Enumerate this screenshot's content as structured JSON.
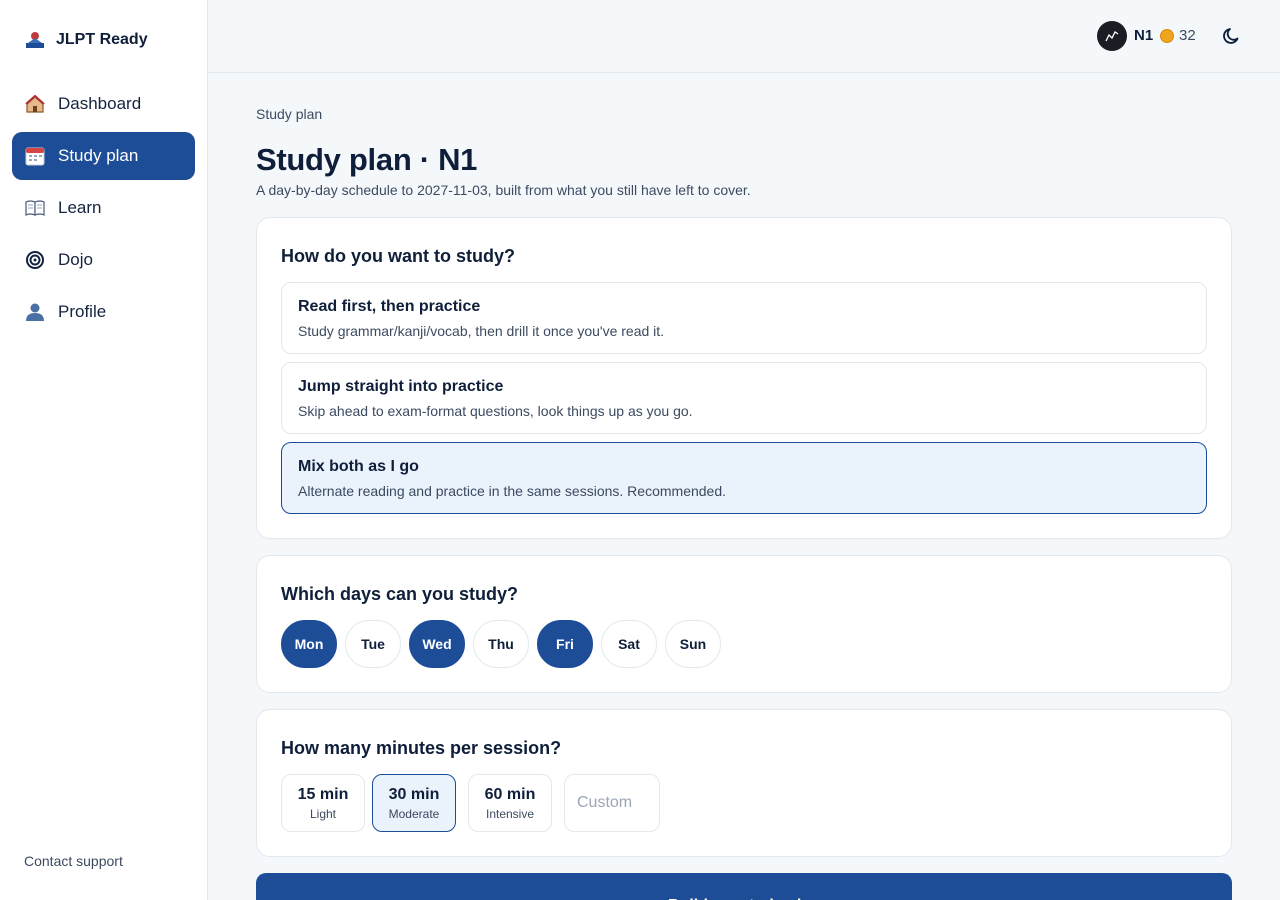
{
  "sidebar": {
    "brand": "JLPT Ready",
    "items": [
      {
        "label": "Dashboard",
        "icon": "house-icon"
      },
      {
        "label": "Study plan",
        "icon": "calendar-icon"
      },
      {
        "label": "Learn",
        "icon": "book-icon"
      },
      {
        "label": "Dojo",
        "icon": "target-icon"
      },
      {
        "label": "Profile",
        "icon": "person-icon"
      }
    ],
    "active_item": "Study plan",
    "support": "Contact support"
  },
  "topbar": {
    "level": "N1",
    "coins": "32",
    "icons": [
      "avatar",
      "coin-icon",
      "moon-icon"
    ]
  },
  "page": {
    "breadcrumb": "Study plan",
    "title": "Study plan · N1",
    "subtitle": "A day-by-day schedule to 2027-11-03, built from what you still have left to cover."
  },
  "study_mode": {
    "heading": "How do you want to study?",
    "options": [
      {
        "title": "Read first, then practice",
        "desc": "Study grammar/kanji/vocab, then drill it once you've read it."
      },
      {
        "title": "Jump straight into practice",
        "desc": "Skip ahead to exam-format questions, look things up as you go."
      },
      {
        "title": "Mix both as I go",
        "desc": "Alternate reading and practice in the same sessions. Recommended."
      }
    ],
    "selected": "Mix both as I go"
  },
  "days": {
    "heading": "Which days can you study?",
    "items": [
      {
        "label": "Mon",
        "on": true
      },
      {
        "label": "Tue",
        "on": false
      },
      {
        "label": "Wed",
        "on": true
      },
      {
        "label": "Thu",
        "on": false
      },
      {
        "label": "Fri",
        "on": true
      },
      {
        "label": "Sat",
        "on": false
      },
      {
        "label": "Sun",
        "on": false
      }
    ]
  },
  "minutes": {
    "heading": "How many minutes per session?",
    "options": [
      {
        "label": "15 min",
        "sub": "Light"
      },
      {
        "label": "30 min",
        "sub": "Moderate"
      },
      {
        "label": "60 min",
        "sub": "Intensive"
      }
    ],
    "selected": "30 min",
    "custom_placeholder": "Custom"
  },
  "cta": {
    "label": "Build my study plan"
  },
  "colors": {
    "accent": "#1d4d96",
    "selected_bg": "#eaf2fb",
    "coin": "#f0a520"
  }
}
